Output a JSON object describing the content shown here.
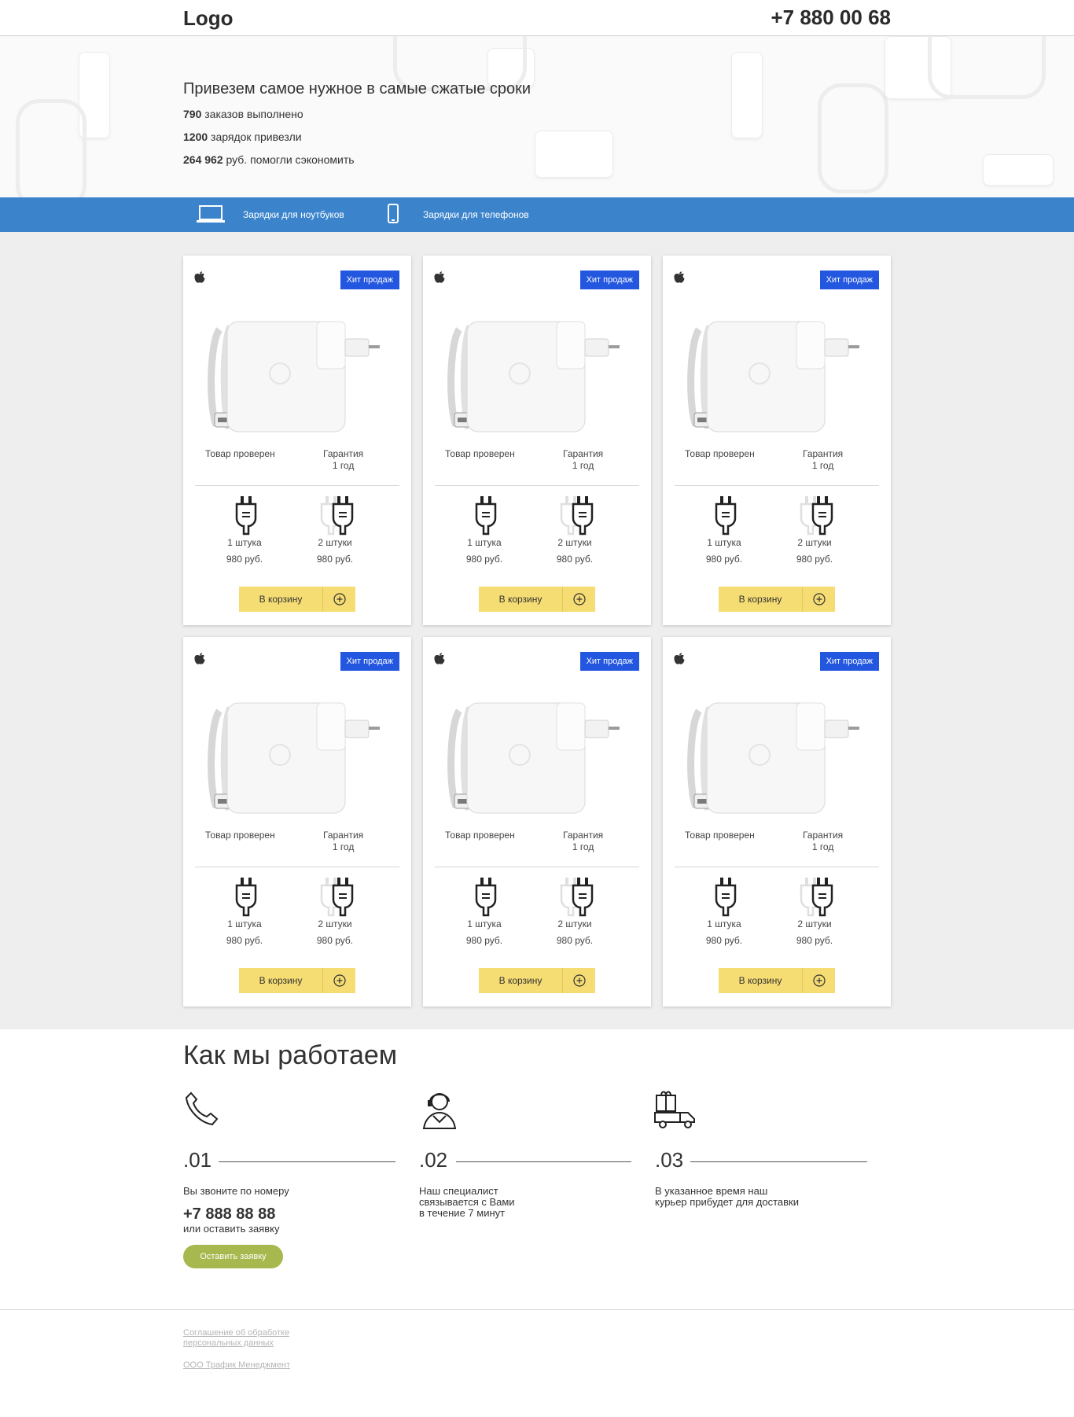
{
  "header": {
    "logo": "Logo",
    "phone": "+7 880 00 68"
  },
  "hero": {
    "title": "Привезем самое нужное в самые сжатые сроки",
    "stats": [
      {
        "value": "790",
        "text": "заказов выполнено"
      },
      {
        "value": "1200",
        "text": "зарядок привезли"
      },
      {
        "value": "264 962",
        "text": "руб. помогли сэкономить"
      }
    ]
  },
  "nav": {
    "items": [
      {
        "label": "Зарядки для ноутбуков",
        "icon": "laptop-icon"
      },
      {
        "label": "Зарядки для телефонов",
        "icon": "phone-icon"
      }
    ]
  },
  "product": {
    "badge": "Хит продаж",
    "brand_icon": "apple-icon",
    "feature1": "Товар проверен",
    "feature2_line1": "Гарантия",
    "feature2_line2": "1 год",
    "opt1_label": "1 штука",
    "opt1_price": "980 руб.",
    "opt2_label": "2 штуки",
    "opt2_price": "980 руб.",
    "cart_label": "В корзину",
    "count": 6
  },
  "how": {
    "title": "Как мы работаем",
    "steps": [
      {
        "num": ".01",
        "icon": "phone-handset-icon",
        "text": "Вы звоните по номеру",
        "phone": "+7 888 88 88",
        "or": "или оставить заявку",
        "button": "Оставить заявку"
      },
      {
        "num": ".02",
        "icon": "operator-icon",
        "line1": "Наш специалист",
        "line2": "связывается с Вами",
        "line3": "в течение 7 минут"
      },
      {
        "num": ".03",
        "icon": "delivery-truck-icon",
        "line1": "В указанное время наш",
        "line2": "курьер прибудет для доставки"
      }
    ]
  },
  "footer": {
    "link1_line1": "Соглашение об обработке",
    "link1_line2": "персональных данных",
    "link2": "ООО Трафик Менеджмент"
  },
  "colors": {
    "nav": "#3b84cc",
    "badge": "#2357e0",
    "cart": "#f5dd73",
    "apply": "#a7b84e"
  }
}
